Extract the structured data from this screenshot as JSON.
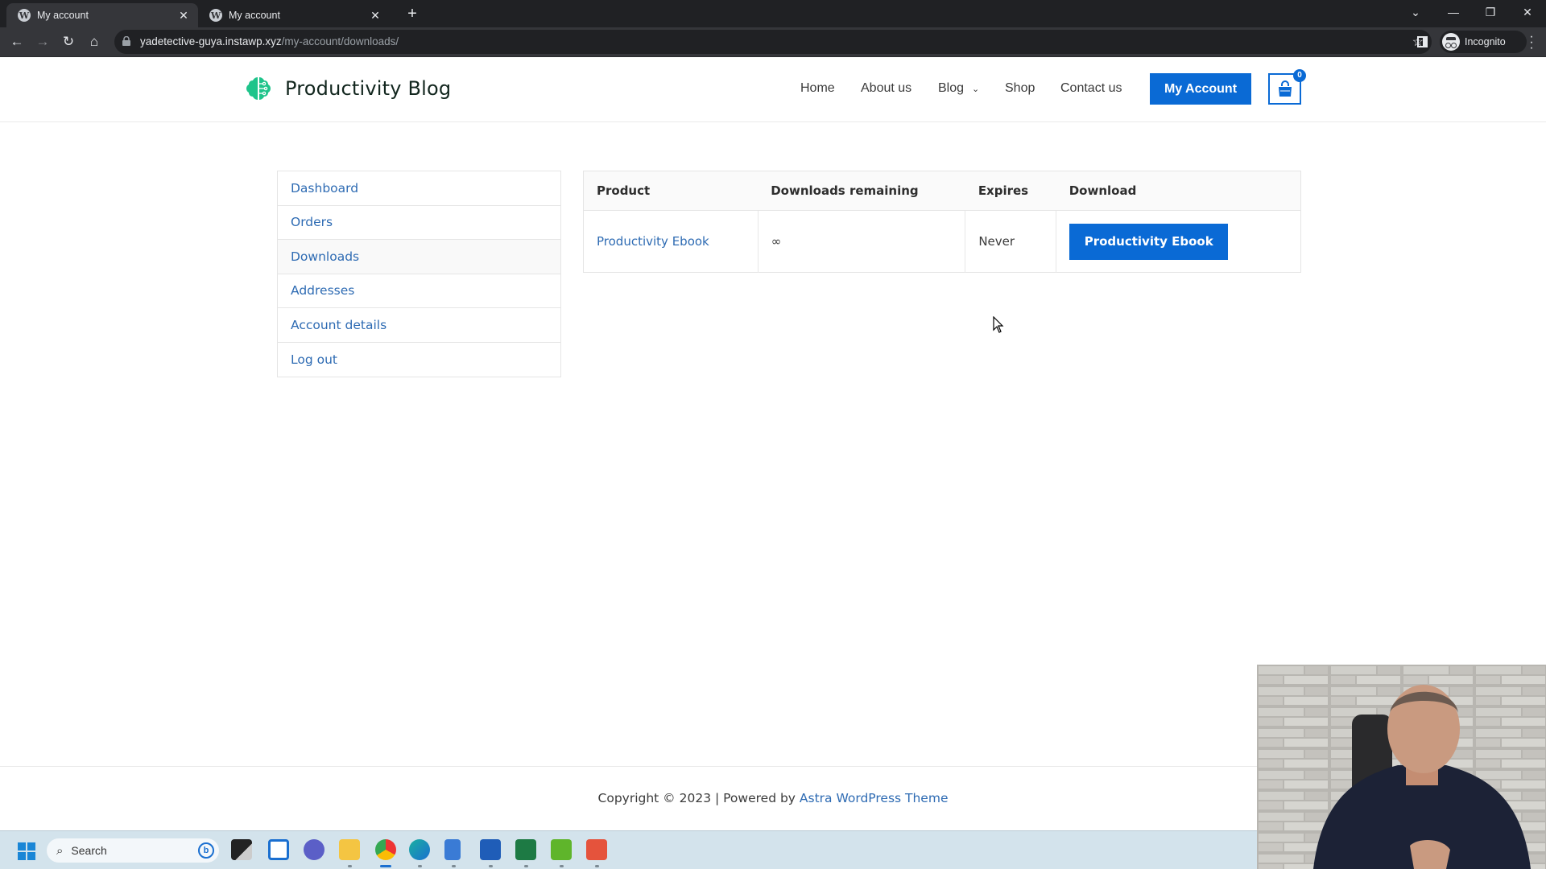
{
  "browser": {
    "tabs": [
      {
        "title": "My account",
        "active": true,
        "favicon": "wordpress-icon"
      },
      {
        "title": "My account",
        "active": false,
        "favicon": "wordpress-icon"
      }
    ],
    "new_tab_label": "+",
    "url_domain": "yadetective-guya.instawp.xyz",
    "url_path": "/my-account/downloads/",
    "incognito_label": "Incognito"
  },
  "site": {
    "title": "Productivity Blog",
    "brand_color": "#0a6ad5",
    "logo_color": "#1fc48b",
    "nav": [
      {
        "label": "Home"
      },
      {
        "label": "About us"
      },
      {
        "label": "Blog",
        "has_dropdown": true
      },
      {
        "label": "Shop"
      },
      {
        "label": "Contact us"
      }
    ],
    "my_account_label": "My Account",
    "cart_count": "0"
  },
  "account_nav": {
    "items": [
      {
        "label": "Dashboard"
      },
      {
        "label": "Orders"
      },
      {
        "label": "Downloads",
        "active": true
      },
      {
        "label": "Addresses"
      },
      {
        "label": "Account details"
      },
      {
        "label": "Log out"
      }
    ]
  },
  "downloads": {
    "columns": [
      "Product",
      "Downloads remaining",
      "Expires",
      "Download"
    ],
    "rows": [
      {
        "product": "Productivity Ebook",
        "remaining": "∞",
        "expires": "Never",
        "download_label": "Productivity Ebook"
      }
    ]
  },
  "footer": {
    "copyright": "Copyright © 2023 | Powered by ",
    "theme_link": "Astra WordPress Theme"
  },
  "taskbar": {
    "search_placeholder": "Search",
    "apps": [
      "file-explorer-icon",
      "task-view-icon",
      "teams-icon",
      "folder-icon",
      "chrome-icon",
      "edge-icon",
      "notepad-icon",
      "word-icon",
      "excel-icon",
      "camtasia-icon",
      "camtasia-recorder-icon"
    ]
  }
}
